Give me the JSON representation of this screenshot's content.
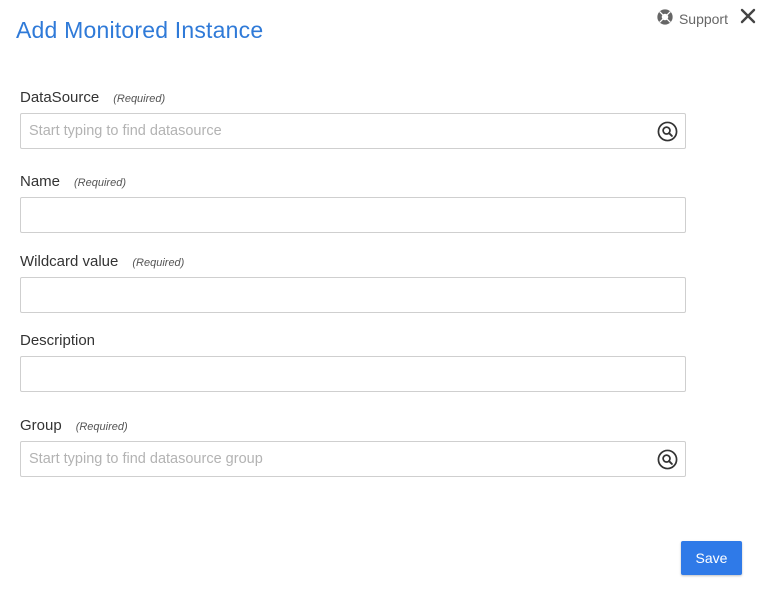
{
  "dialog": {
    "title": "Add Monitored Instance",
    "support_label": "Support"
  },
  "fields": {
    "datasource": {
      "label": "DataSource",
      "required_note": "(Required)",
      "value": "",
      "placeholder": "Start typing to find datasource"
    },
    "name": {
      "label": "Name",
      "required_note": "(Required)",
      "value": "",
      "placeholder": ""
    },
    "wildcard": {
      "label": "Wildcard value",
      "required_note": "(Required)",
      "value": "",
      "placeholder": ""
    },
    "description": {
      "label": "Description",
      "value": "",
      "placeholder": ""
    },
    "group": {
      "label": "Group",
      "required_note": "(Required)",
      "value": "",
      "placeholder": "Start typing to find datasource group"
    }
  },
  "actions": {
    "save_label": "Save"
  },
  "icons": {
    "support": "lifebuoy-icon",
    "close": "close-icon",
    "search": "search-icon"
  },
  "colors": {
    "title": "#2f7ad8",
    "primary_button": "#2f7ae8",
    "input_border": "#cfcfcf",
    "placeholder": "#b3b3b3"
  }
}
